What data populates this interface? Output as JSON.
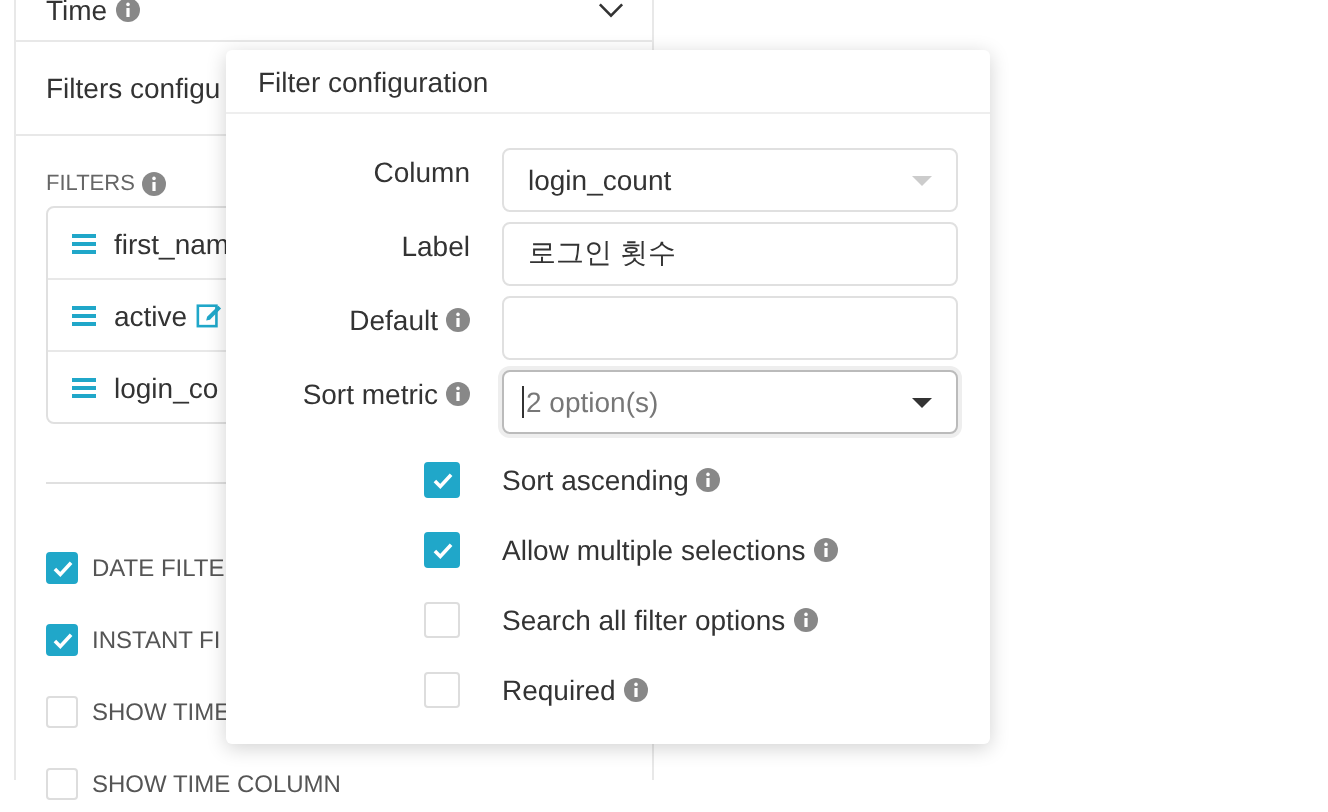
{
  "panel": {
    "time_title": "Time",
    "filters_section_title": "Filters configu",
    "filters_label": "FILTERS",
    "filters": [
      {
        "name": "first_nam",
        "editable": false
      },
      {
        "name": "active",
        "editable": true
      },
      {
        "name": "login_co",
        "editable": false
      }
    ],
    "options": [
      {
        "label": "DATE FILTE",
        "checked": true
      },
      {
        "label": "INSTANT FI",
        "checked": true
      },
      {
        "label": "SHOW TIME",
        "checked": false
      },
      {
        "label": "SHOW TIME COLUMN",
        "checked": false
      }
    ]
  },
  "popover": {
    "title": "Filter configuration",
    "fields": [
      {
        "label": "Column",
        "info": false,
        "kind": "select",
        "value": "login_count",
        "focused": false
      },
      {
        "label": "Label",
        "info": false,
        "kind": "text",
        "value": "로그인 횟수",
        "focused": false
      },
      {
        "label": "Default",
        "info": true,
        "kind": "text",
        "focused": false
      },
      {
        "label": "Sort metric",
        "info": true,
        "kind": "select",
        "placeholder": "2 option(s)",
        "focused": true
      }
    ],
    "checks": [
      {
        "label": "Sort ascending",
        "info": true,
        "checked": true
      },
      {
        "label": "Allow multiple selections",
        "info": true,
        "checked": true
      },
      {
        "label": "Search all filter options",
        "info": true,
        "checked": false
      },
      {
        "label": "Required",
        "info": true,
        "checked": false
      }
    ]
  }
}
